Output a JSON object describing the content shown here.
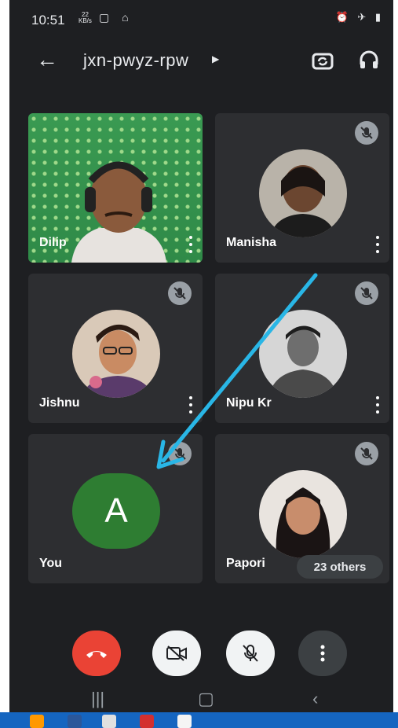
{
  "status": {
    "time": "10:51",
    "speed_top": "22",
    "speed_unit": "KB/s"
  },
  "meeting": {
    "code": "jxn-pwyz-rpw"
  },
  "participants": [
    {
      "name": "Dilip"
    },
    {
      "name": "Manisha"
    },
    {
      "name": "Jishnu"
    },
    {
      "name": "Nipu Kr"
    },
    {
      "name": "You",
      "initial": "A"
    },
    {
      "name": "Papori"
    }
  ],
  "others_label": "23 others",
  "colors": {
    "background": "#1e1f22",
    "tile": "#2d2e31",
    "end_call": "#ea4335",
    "avatar_green": "#2e7d32",
    "annotation_arrow": "#29b6e6"
  },
  "icons": {
    "back": "arrow-left-icon",
    "switch_camera": "switch-camera-icon",
    "audio": "headphones-icon",
    "mic_off": "mic-off-icon",
    "more": "more-vert-icon",
    "end_call": "call-end-icon",
    "camera_off": "videocam-off-icon"
  }
}
